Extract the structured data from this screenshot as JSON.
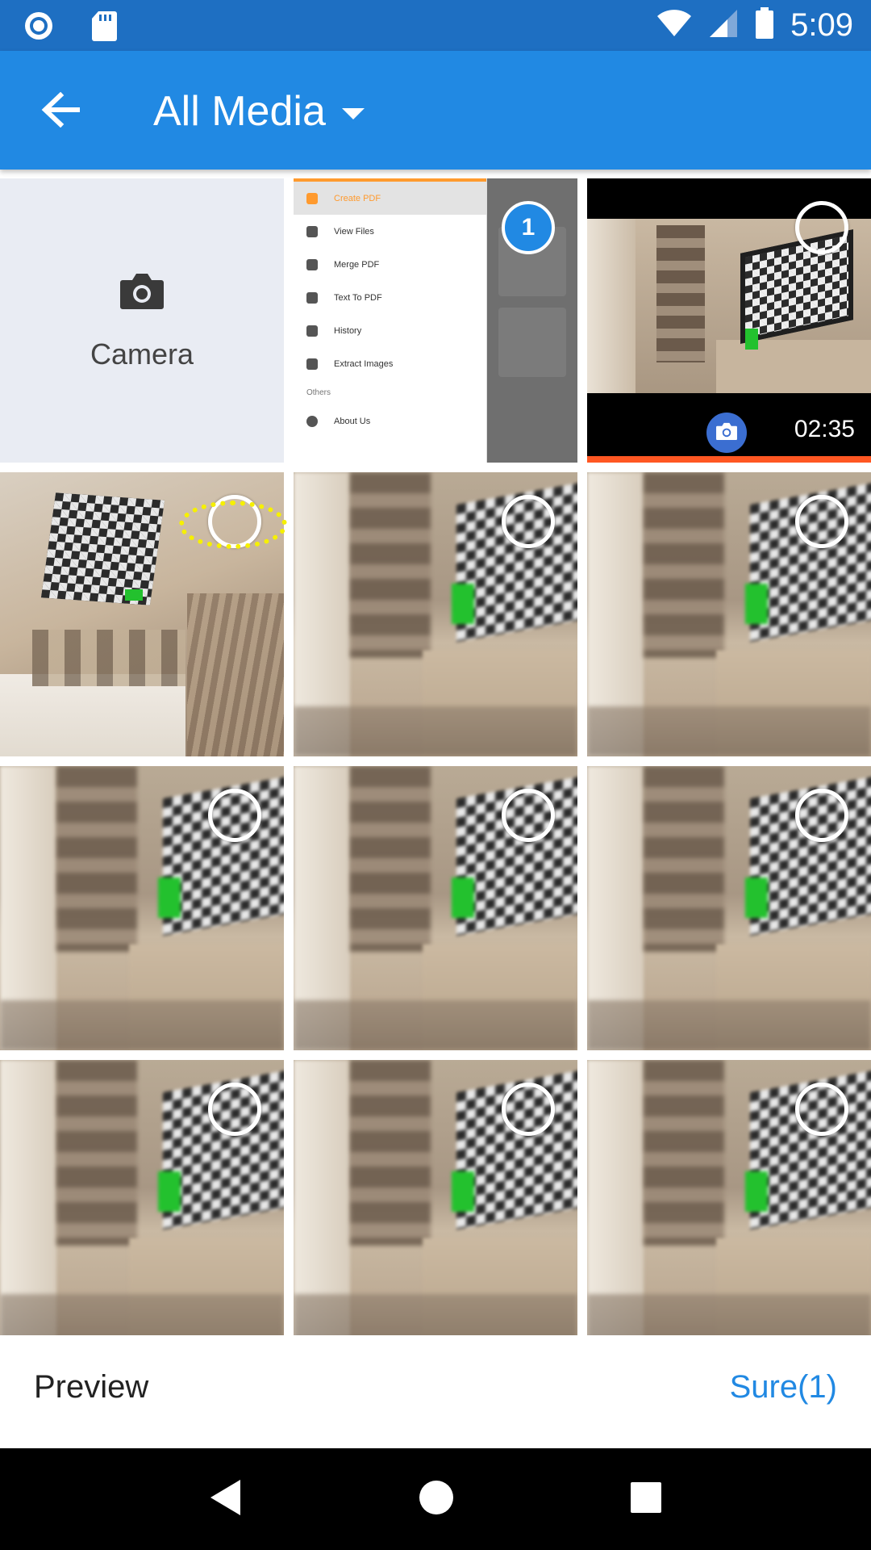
{
  "status_bar": {
    "time": "5:09",
    "left_icons": [
      "record-icon",
      "sd-card-icon"
    ],
    "right_icons": [
      "wifi-icon",
      "signal-icon",
      "battery-icon"
    ]
  },
  "app_bar": {
    "title": "All Media",
    "back_icon": "arrow-left-icon",
    "dropdown_icon": "caret-down-icon",
    "background": "#2189e3"
  },
  "camera_tile": {
    "label": "Camera",
    "icon": "camera-icon"
  },
  "screenshot_tile": {
    "selected_number": "1",
    "menu_items": [
      "Create PDF",
      "View Files",
      "Merge PDF",
      "Text To PDF",
      "History",
      "Extract Images",
      "Others",
      "About Us"
    ]
  },
  "video_tile": {
    "duration": "02:35",
    "badge_icon": "camera-icon"
  },
  "bottom_bar": {
    "preview_label": "Preview",
    "sure_label": "Sure(1)"
  },
  "nav_bar": {
    "icons": [
      "back-triangle-icon",
      "home-circle-icon",
      "recents-square-icon"
    ]
  },
  "colors": {
    "accent": "#2189e3",
    "status_bar": "#1e6fc2",
    "video_progress": "#ff5722",
    "highlight": "#f6f000"
  }
}
